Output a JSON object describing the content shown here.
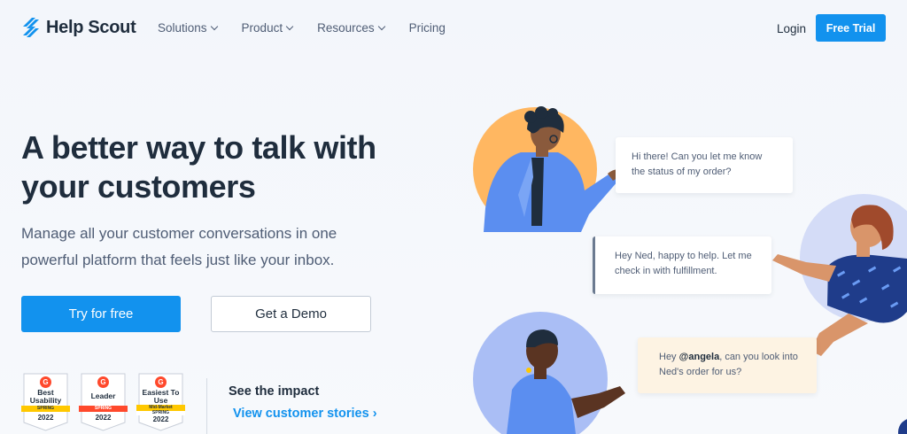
{
  "nav": {
    "brand": "Help Scout",
    "links": [
      {
        "label": "Solutions",
        "dropdown": true
      },
      {
        "label": "Product",
        "dropdown": true
      },
      {
        "label": "Resources",
        "dropdown": true
      },
      {
        "label": "Pricing",
        "dropdown": false
      }
    ],
    "login": "Login",
    "trial": "Free Trial"
  },
  "hero": {
    "headline": "A better way to talk with your customers",
    "subhead": "Manage all your customer conversations in one powerful platform that feels just like your inbox.",
    "primary_cta": "Try for free",
    "secondary_cta": "Get a Demo"
  },
  "badges": [
    {
      "title": "Best Usability",
      "ribbon": "SPRING",
      "year": "2022",
      "ribbon_color": "#ffc800"
    },
    {
      "title": "Leader",
      "ribbon": "SPRING",
      "year": "2022",
      "ribbon_color": "#ff492c"
    },
    {
      "title": "Easiest To Use",
      "ribbon": "Mid-Market",
      "ribbon2": "SPRING",
      "year": "2022",
      "ribbon_color": "#ffc800"
    }
  ],
  "impact": {
    "title": "See the impact",
    "link": "View customer stories ›"
  },
  "chat": {
    "msg1": "Hi there! Can you let me know the status of my order?",
    "msg2": "Hey Ned, happy to help. Let me check in with fulfillment.",
    "msg3_prefix": "Hey ",
    "msg3_mention": "@angela",
    "msg3_suffix": ", can you look into Ned's order for us?"
  },
  "colors": {
    "accent": "#1292ee",
    "text_dark": "#1f2d3d",
    "text_muted": "#4f5d75",
    "orange_circle": "#ffb761",
    "lavender_circle": "#d4dcf7",
    "blue_circle": "#aabef5"
  }
}
